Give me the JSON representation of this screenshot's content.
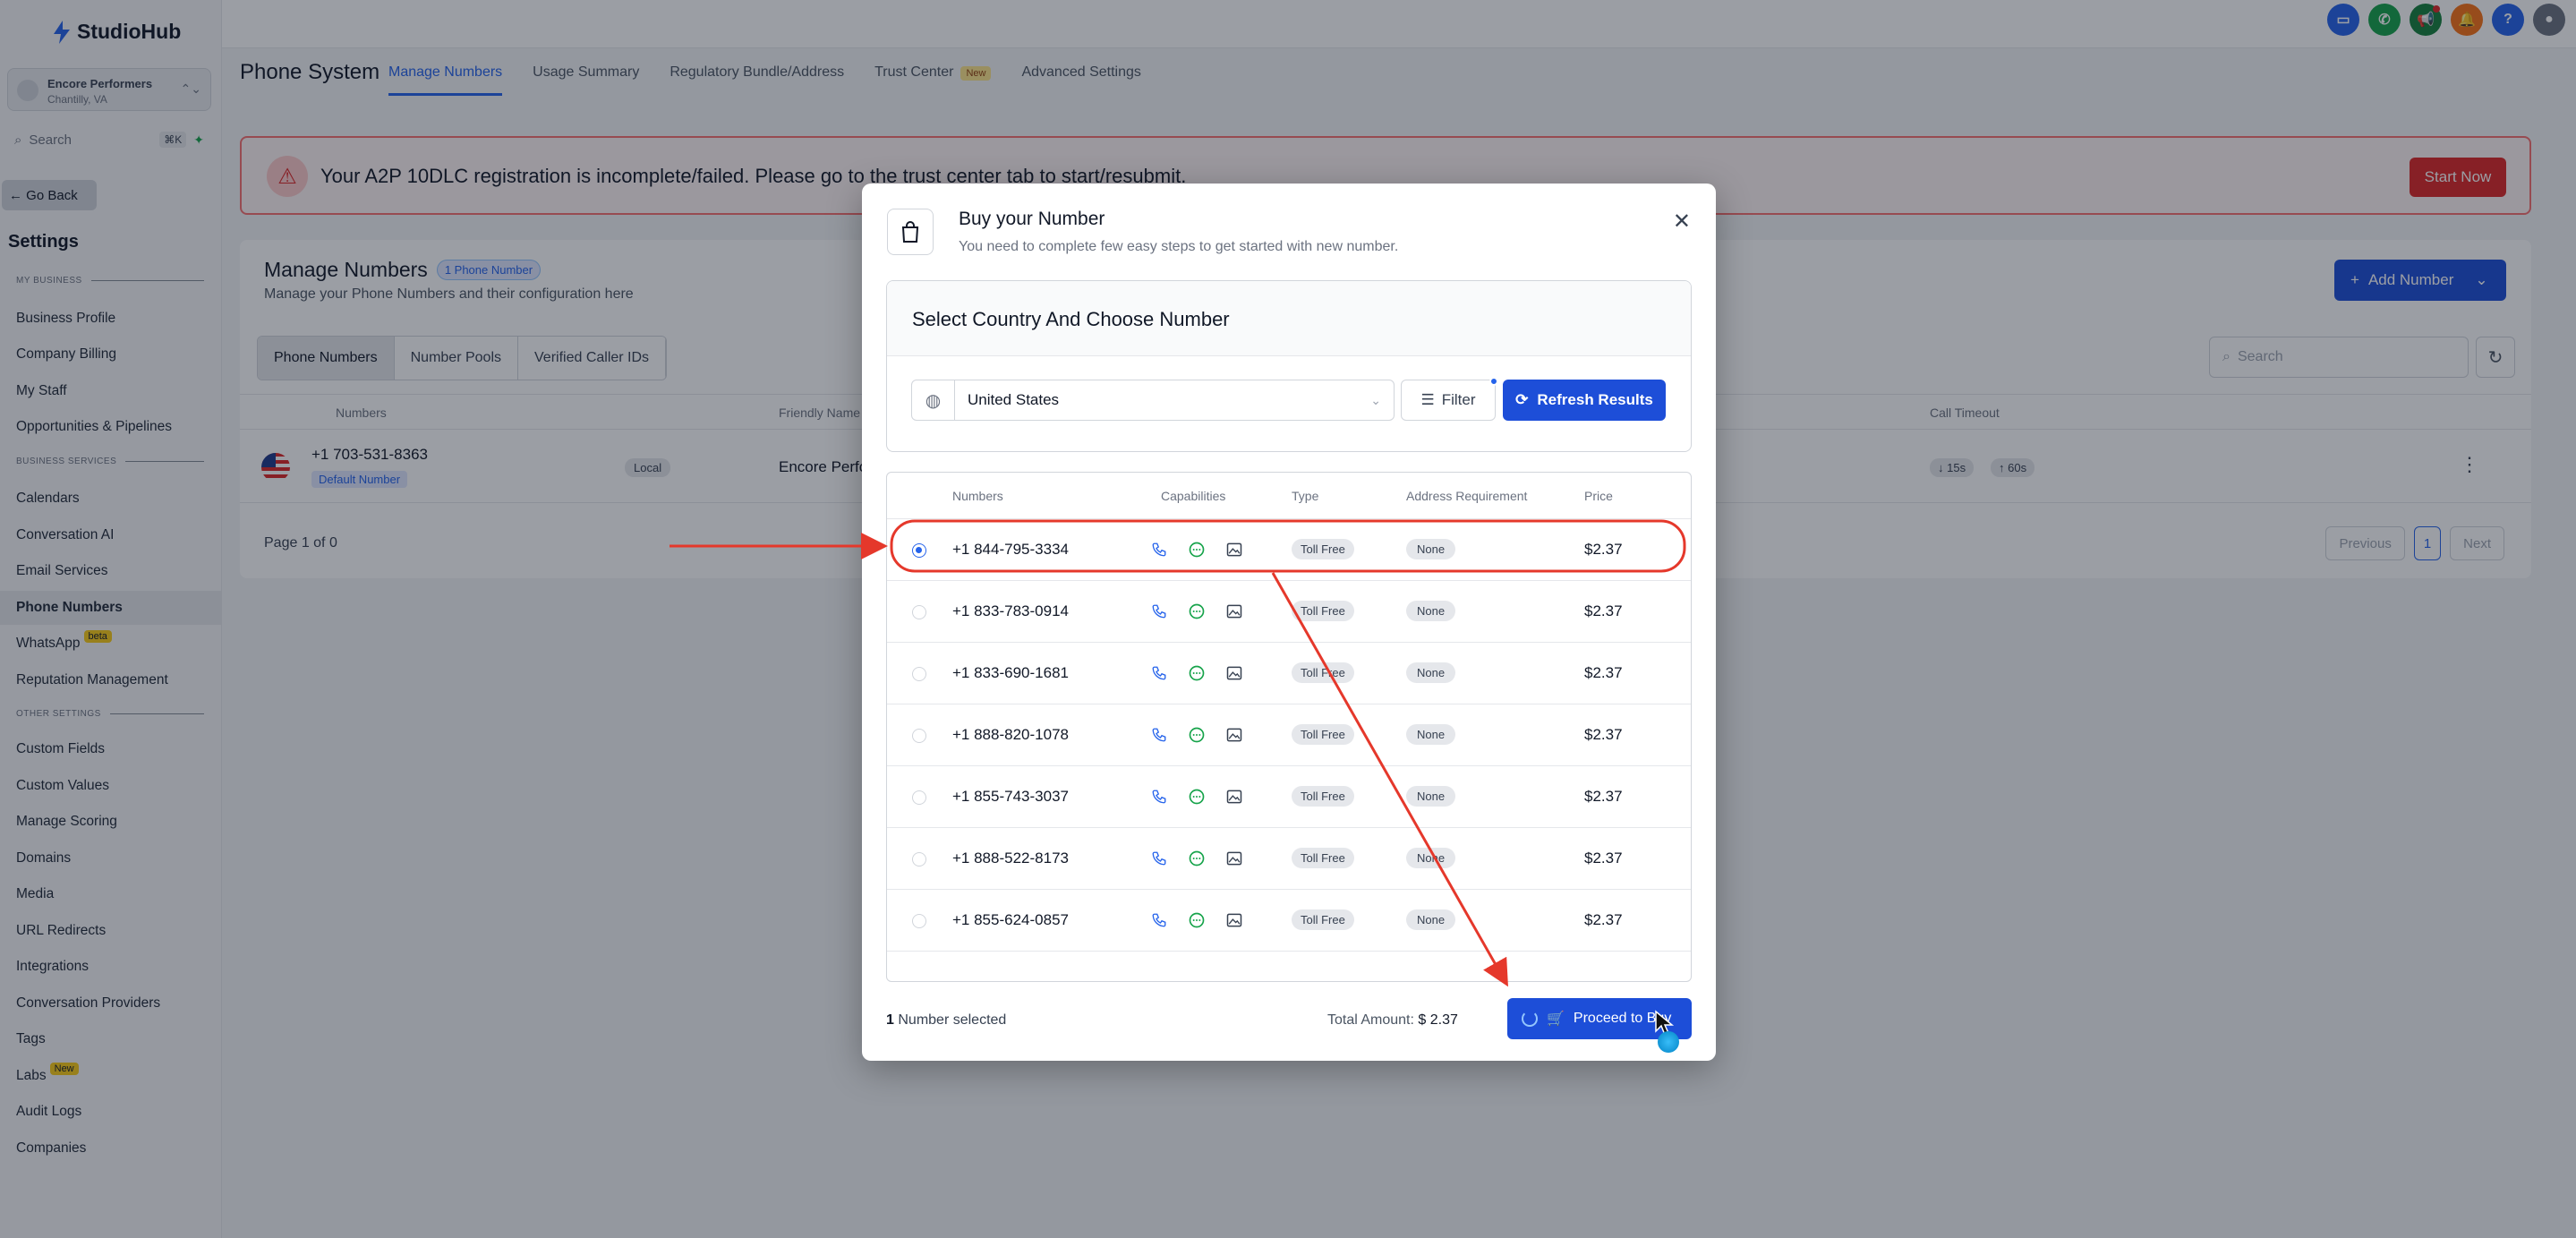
{
  "app": {
    "logo_text": "StudioHub",
    "brand_color": "#2563eb"
  },
  "sidebar": {
    "location_name": "Encore Performers",
    "location_sub": "Chantilly, VA",
    "search_label": "Search",
    "search_shortcut": "⌘K",
    "go_back": "Go Back",
    "settings_title": "Settings",
    "section_my_business": "MY BUSINESS",
    "section_business_services": "BUSINESS SERVICES",
    "section_other_settings": "OTHER SETTINGS",
    "items": [
      "Business Profile",
      "Company Billing",
      "My Staff",
      "Opportunities & Pipelines",
      "Calendars",
      "Conversation AI",
      "Email Services",
      "Phone Numbers",
      "WhatsApp",
      "Reputation Management",
      "Custom Fields",
      "Custom Values",
      "Manage Scoring",
      "Domains",
      "Media",
      "URL Redirects",
      "Integrations",
      "Conversation Providers",
      "Tags",
      "Labs",
      "Audit Logs",
      "Companies"
    ],
    "whatsapp_badge": "beta",
    "labs_badge": "New",
    "active_item": "Phone Numbers"
  },
  "header": {
    "title": "Phone System",
    "tabs": [
      "Manage Numbers",
      "Usage Summary",
      "Regulatory Bundle/Address",
      "Trust Center",
      "Advanced Settings"
    ],
    "trust_badge": "New",
    "active_tab": "Manage Numbers"
  },
  "alert": {
    "text": "Your A2P 10DLC registration is incomplete/failed. Please go to the trust center tab to start/resubmit.",
    "button": "Start Now",
    "color": "#dc2626"
  },
  "manage": {
    "title": "Manage Numbers",
    "count_badge": "1 Phone Number",
    "subtitle": "Manage your Phone Numbers and their configuration here",
    "add_button": "Add Number",
    "subtabs": [
      "Phone Numbers",
      "Number Pools",
      "Verified Caller IDs"
    ],
    "search_placeholder": "Search",
    "columns": {
      "numbers": "Numbers",
      "friendly": "Friendly Name",
      "timeout": "Call Timeout"
    },
    "row": {
      "number": "+1 703-531-8363",
      "default_badge": "Default Number",
      "type": "Local",
      "friendly": "Encore Perfo",
      "timeout_in": "15s",
      "timeout_out": "60s"
    },
    "page_text": "Page 1 of 0",
    "pager": {
      "previous": "Previous",
      "page": "1",
      "next": "Next"
    }
  },
  "modal": {
    "title": "Buy your Number",
    "subtitle": "You need to complete few easy steps to get started with new number.",
    "section_title": "Select Country And Choose Number",
    "country": "United States",
    "filter": "Filter",
    "refresh": "Refresh Results",
    "columns": {
      "numbers": "Numbers",
      "capabilities": "Capabilities",
      "type": "Type",
      "address": "Address Requirement",
      "price": "Price"
    },
    "rows": [
      {
        "number": "+1 844-795-3334",
        "type": "Toll Free",
        "address": "None",
        "price": "$2.37",
        "selected": true
      },
      {
        "number": "+1 833-783-0914",
        "type": "Toll Free",
        "address": "None",
        "price": "$2.37",
        "selected": false
      },
      {
        "number": "+1 833-690-1681",
        "type": "Toll Free",
        "address": "None",
        "price": "$2.37",
        "selected": false
      },
      {
        "number": "+1 888-820-1078",
        "type": "Toll Free",
        "address": "None",
        "price": "$2.37",
        "selected": false
      },
      {
        "number": "+1 855-743-3037",
        "type": "Toll Free",
        "address": "None",
        "price": "$2.37",
        "selected": false
      },
      {
        "number": "+1 888-522-8173",
        "type": "Toll Free",
        "address": "None",
        "price": "$2.37",
        "selected": false
      },
      {
        "number": "+1 855-624-0857",
        "type": "Toll Free",
        "address": "None",
        "price": "$2.37",
        "selected": false
      }
    ],
    "selected_count": "1",
    "selected_label": "Number selected",
    "total_label": "Total Amount:",
    "total_value": "$ 2.37",
    "proceed": "Proceed to Buy"
  }
}
